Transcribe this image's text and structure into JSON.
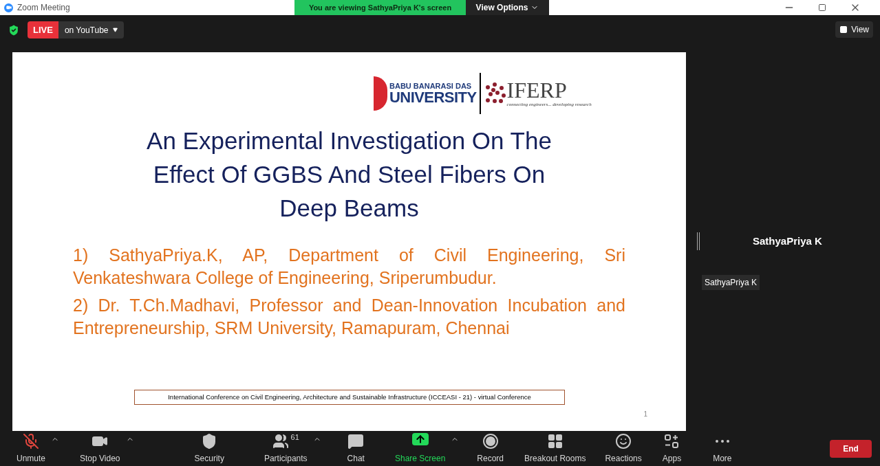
{
  "window": {
    "title": "Zoom Meeting"
  },
  "share_banner": {
    "text": "You are viewing SathyaPriya K's screen",
    "button": "View Options"
  },
  "live": {
    "badge": "LIVE",
    "target": "on YouTube"
  },
  "view_button": "View",
  "slide": {
    "logo_left": {
      "line1": "BABU BANARASI DAS",
      "line2": "UNIVERSITY"
    },
    "logo_right": {
      "name": "IFERP",
      "tagline": "connecting engineers... developing research"
    },
    "title": "An Experimental Investigation On The Effect Of GGBS And Steel Fibers On Deep Beams",
    "authors": [
      "1) SathyaPriya.K, AP, Department of Civil Engineering, Sri Venkateshwara College of Engineering, Sriperumbudur.",
      "2) Dr. T.Ch.Madhavi, Professor and Dean-Innovation Incubation and Entrepreneurship, SRM University, Ramapuram, Chennai"
    ],
    "footer": "International Conference on Civil Engineering, Architecture and Sustainable Infrastructure (ICCEASI - 21) - virtual Conference",
    "page_number": "1"
  },
  "participant": {
    "name": "SathyaPriya K",
    "label": "SathyaPriya K"
  },
  "toolbar": [
    {
      "kind": "mic",
      "label": "Unmute",
      "muted": true,
      "caret": true
    },
    {
      "kind": "video",
      "label": "Stop Video",
      "caret": true
    },
    {
      "kind": "security",
      "label": "Security",
      "caret": false
    },
    {
      "kind": "participants",
      "label": "Participants",
      "count": "61",
      "caret": true
    },
    {
      "kind": "chat",
      "label": "Chat",
      "caret": false
    },
    {
      "kind": "share",
      "label": "Share Screen",
      "caret": true
    },
    {
      "kind": "record",
      "label": "Record",
      "caret": false
    },
    {
      "kind": "breakout",
      "label": "Breakout Rooms",
      "caret": false
    },
    {
      "kind": "reactions",
      "label": "Reactions",
      "caret": false
    },
    {
      "kind": "apps",
      "label": "Apps",
      "caret": false
    },
    {
      "kind": "more",
      "label": "More",
      "caret": false
    }
  ],
  "end_button": "End"
}
